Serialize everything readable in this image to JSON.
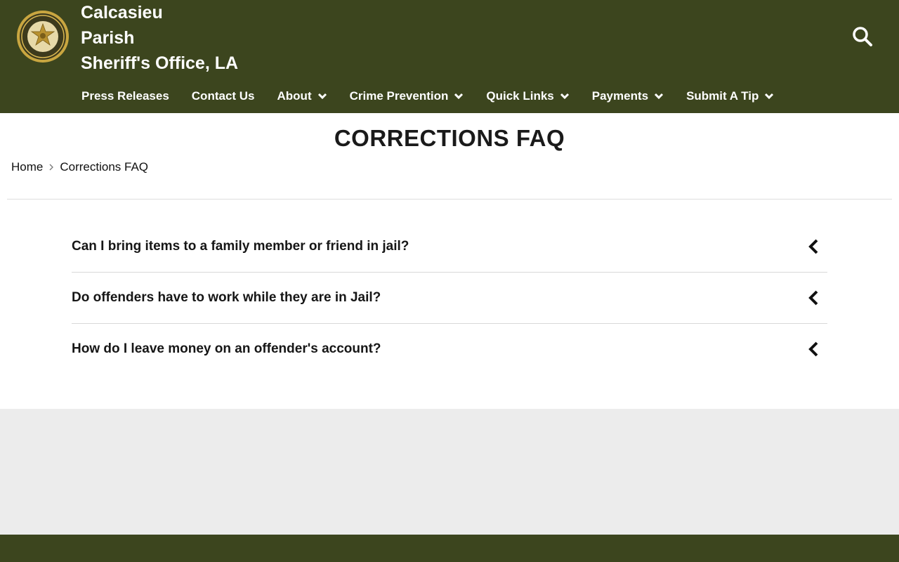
{
  "header": {
    "title_lines": [
      "Calcasieu",
      "Parish",
      "Sheriff's Office, LA"
    ],
    "logo_icon": "sheriff-badge-icon",
    "search_icon": "search-icon",
    "colors": {
      "brand": "#3c451e",
      "text": "#ffffff"
    }
  },
  "nav": {
    "items": [
      {
        "label": "Press Releases",
        "dropdown": false
      },
      {
        "label": "Contact Us",
        "dropdown": false
      },
      {
        "label": "About",
        "dropdown": true
      },
      {
        "label": "Crime Prevention",
        "dropdown": true
      },
      {
        "label": "Quick Links",
        "dropdown": true
      },
      {
        "label": "Payments",
        "dropdown": true
      },
      {
        "label": "Submit A Tip",
        "dropdown": true
      }
    ]
  },
  "page": {
    "title": "CORRECTIONS FAQ",
    "breadcrumb": [
      "Home",
      "Corrections FAQ"
    ]
  },
  "faq": {
    "items": [
      {
        "question": "Can I bring items to a family member or friend in jail?",
        "expanded": false
      },
      {
        "question": "Do offenders have to work while they are in Jail?",
        "expanded": false
      },
      {
        "question": "How do I leave money on an offender's account?",
        "expanded": false
      }
    ]
  }
}
